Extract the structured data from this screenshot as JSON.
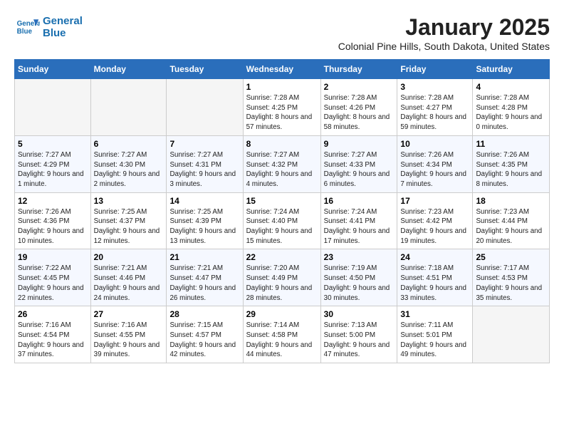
{
  "header": {
    "logo_line1": "General",
    "logo_line2": "Blue",
    "title": "January 2025",
    "subtitle": "Colonial Pine Hills, South Dakota, United States"
  },
  "days_of_week": [
    "Sunday",
    "Monday",
    "Tuesday",
    "Wednesday",
    "Thursday",
    "Friday",
    "Saturday"
  ],
  "weeks": [
    [
      {
        "num": "",
        "info": ""
      },
      {
        "num": "",
        "info": ""
      },
      {
        "num": "",
        "info": ""
      },
      {
        "num": "1",
        "info": "Sunrise: 7:28 AM\nSunset: 4:25 PM\nDaylight: 8 hours and 57 minutes."
      },
      {
        "num": "2",
        "info": "Sunrise: 7:28 AM\nSunset: 4:26 PM\nDaylight: 8 hours and 58 minutes."
      },
      {
        "num": "3",
        "info": "Sunrise: 7:28 AM\nSunset: 4:27 PM\nDaylight: 8 hours and 59 minutes."
      },
      {
        "num": "4",
        "info": "Sunrise: 7:28 AM\nSunset: 4:28 PM\nDaylight: 9 hours and 0 minutes."
      }
    ],
    [
      {
        "num": "5",
        "info": "Sunrise: 7:27 AM\nSunset: 4:29 PM\nDaylight: 9 hours and 1 minute."
      },
      {
        "num": "6",
        "info": "Sunrise: 7:27 AM\nSunset: 4:30 PM\nDaylight: 9 hours and 2 minutes."
      },
      {
        "num": "7",
        "info": "Sunrise: 7:27 AM\nSunset: 4:31 PM\nDaylight: 9 hours and 3 minutes."
      },
      {
        "num": "8",
        "info": "Sunrise: 7:27 AM\nSunset: 4:32 PM\nDaylight: 9 hours and 4 minutes."
      },
      {
        "num": "9",
        "info": "Sunrise: 7:27 AM\nSunset: 4:33 PM\nDaylight: 9 hours and 6 minutes."
      },
      {
        "num": "10",
        "info": "Sunrise: 7:26 AM\nSunset: 4:34 PM\nDaylight: 9 hours and 7 minutes."
      },
      {
        "num": "11",
        "info": "Sunrise: 7:26 AM\nSunset: 4:35 PM\nDaylight: 9 hours and 8 minutes."
      }
    ],
    [
      {
        "num": "12",
        "info": "Sunrise: 7:26 AM\nSunset: 4:36 PM\nDaylight: 9 hours and 10 minutes."
      },
      {
        "num": "13",
        "info": "Sunrise: 7:25 AM\nSunset: 4:37 PM\nDaylight: 9 hours and 12 minutes."
      },
      {
        "num": "14",
        "info": "Sunrise: 7:25 AM\nSunset: 4:39 PM\nDaylight: 9 hours and 13 minutes."
      },
      {
        "num": "15",
        "info": "Sunrise: 7:24 AM\nSunset: 4:40 PM\nDaylight: 9 hours and 15 minutes."
      },
      {
        "num": "16",
        "info": "Sunrise: 7:24 AM\nSunset: 4:41 PM\nDaylight: 9 hours and 17 minutes."
      },
      {
        "num": "17",
        "info": "Sunrise: 7:23 AM\nSunset: 4:42 PM\nDaylight: 9 hours and 19 minutes."
      },
      {
        "num": "18",
        "info": "Sunrise: 7:23 AM\nSunset: 4:44 PM\nDaylight: 9 hours and 20 minutes."
      }
    ],
    [
      {
        "num": "19",
        "info": "Sunrise: 7:22 AM\nSunset: 4:45 PM\nDaylight: 9 hours and 22 minutes."
      },
      {
        "num": "20",
        "info": "Sunrise: 7:21 AM\nSunset: 4:46 PM\nDaylight: 9 hours and 24 minutes."
      },
      {
        "num": "21",
        "info": "Sunrise: 7:21 AM\nSunset: 4:47 PM\nDaylight: 9 hours and 26 minutes."
      },
      {
        "num": "22",
        "info": "Sunrise: 7:20 AM\nSunset: 4:49 PM\nDaylight: 9 hours and 28 minutes."
      },
      {
        "num": "23",
        "info": "Sunrise: 7:19 AM\nSunset: 4:50 PM\nDaylight: 9 hours and 30 minutes."
      },
      {
        "num": "24",
        "info": "Sunrise: 7:18 AM\nSunset: 4:51 PM\nDaylight: 9 hours and 33 minutes."
      },
      {
        "num": "25",
        "info": "Sunrise: 7:17 AM\nSunset: 4:53 PM\nDaylight: 9 hours and 35 minutes."
      }
    ],
    [
      {
        "num": "26",
        "info": "Sunrise: 7:16 AM\nSunset: 4:54 PM\nDaylight: 9 hours and 37 minutes."
      },
      {
        "num": "27",
        "info": "Sunrise: 7:16 AM\nSunset: 4:55 PM\nDaylight: 9 hours and 39 minutes."
      },
      {
        "num": "28",
        "info": "Sunrise: 7:15 AM\nSunset: 4:57 PM\nDaylight: 9 hours and 42 minutes."
      },
      {
        "num": "29",
        "info": "Sunrise: 7:14 AM\nSunset: 4:58 PM\nDaylight: 9 hours and 44 minutes."
      },
      {
        "num": "30",
        "info": "Sunrise: 7:13 AM\nSunset: 5:00 PM\nDaylight: 9 hours and 47 minutes."
      },
      {
        "num": "31",
        "info": "Sunrise: 7:11 AM\nSunset: 5:01 PM\nDaylight: 9 hours and 49 minutes."
      },
      {
        "num": "",
        "info": ""
      }
    ]
  ]
}
